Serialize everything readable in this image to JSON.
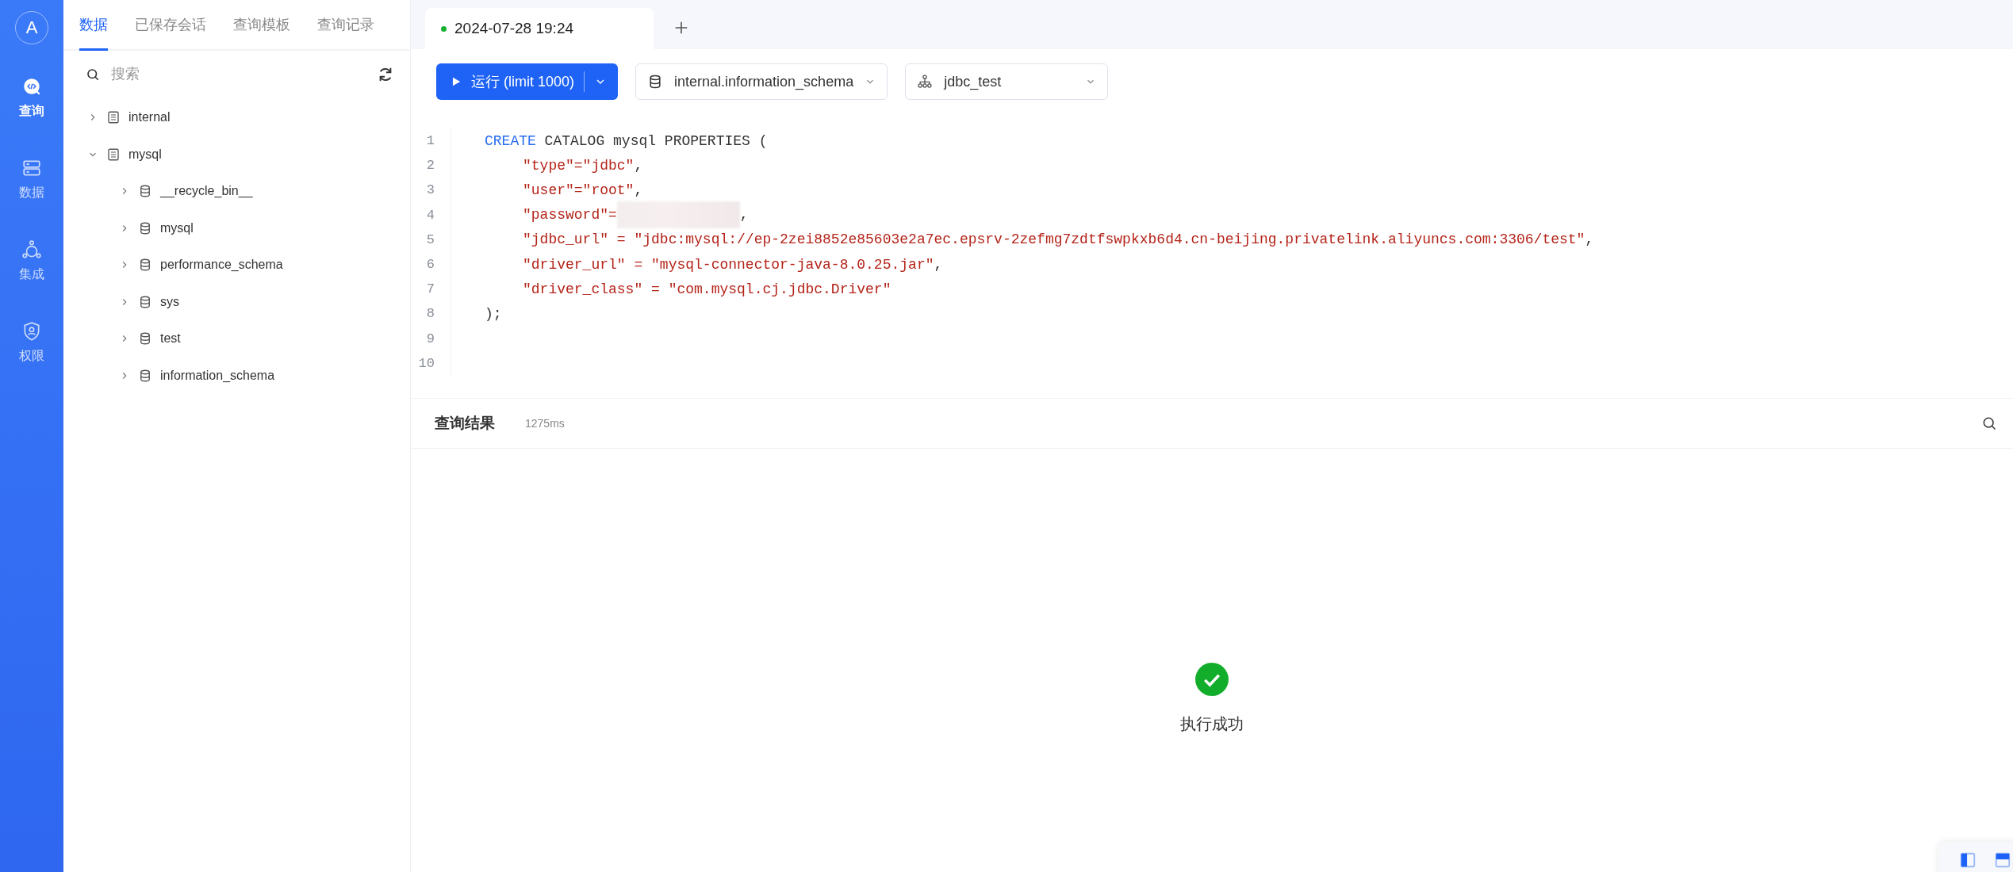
{
  "nav": {
    "avatar": "A",
    "items": [
      {
        "label": "查询",
        "selected": true
      },
      {
        "label": "数据",
        "selected": false
      },
      {
        "label": "集成",
        "selected": false
      },
      {
        "label": "权限",
        "selected": false
      }
    ]
  },
  "sidebar": {
    "tabs": [
      {
        "label": "数据",
        "selected": true
      },
      {
        "label": "已保存会话",
        "selected": false
      },
      {
        "label": "查询模板",
        "selected": false
      },
      {
        "label": "查询记录",
        "selected": false
      }
    ],
    "search": {
      "placeholder": "搜索"
    },
    "tree": [
      {
        "label": "internal",
        "kind": "catalog",
        "expanded": false
      },
      {
        "label": "mysql",
        "kind": "catalog",
        "expanded": true,
        "children": [
          {
            "label": "__recycle_bin__",
            "kind": "database",
            "expanded": false
          },
          {
            "label": "mysql",
            "kind": "database",
            "expanded": false
          },
          {
            "label": "performance_schema",
            "kind": "database",
            "expanded": false
          },
          {
            "label": "sys",
            "kind": "database",
            "expanded": false
          },
          {
            "label": "test",
            "kind": "database",
            "expanded": false
          },
          {
            "label": "information_schema",
            "kind": "database",
            "expanded": false
          }
        ]
      }
    ]
  },
  "editor_tabs": [
    {
      "label": "2024-07-28 19:24",
      "selected": true,
      "color": "#16b030"
    }
  ],
  "toolbar": {
    "run_button": "运行 (limit 1000)",
    "database_select": "internal.information_schema",
    "cluster_select": "jdbc_test"
  },
  "code": [
    {
      "number": "1",
      "indent": false,
      "tokens": [
        {
          "kind": "keyword",
          "text": "CREATE"
        },
        {
          "kind": "plain",
          "text": " CATALOG mysql PROPERTIES ("
        }
      ]
    },
    {
      "number": "2",
      "indent": true,
      "tokens": [
        {
          "kind": "string",
          "text": "\"type\"=\"jdbc\""
        },
        {
          "kind": "plain",
          "text": ","
        }
      ]
    },
    {
      "number": "3",
      "indent": true,
      "tokens": [
        {
          "kind": "string",
          "text": "\"user\"=\"root\""
        },
        {
          "kind": "plain",
          "text": ","
        }
      ]
    },
    {
      "number": "4",
      "indent": true,
      "tokens": [
        {
          "kind": "string",
          "text": "\"password\"="
        },
        {
          "kind": "redacted"
        },
        {
          "kind": "plain",
          "text": ","
        }
      ]
    },
    {
      "number": "5",
      "indent": true,
      "tokens": [
        {
          "kind": "string",
          "text": "\"jdbc_url\" = \"jdbc:mysql://ep-2zei8852e85603e2a7ec.epsrv-2zefmg7zdtfswpkxb6d4.cn-beijing.privatelink.aliyuncs.com:3306/test\""
        },
        {
          "kind": "plain",
          "text": ","
        }
      ]
    },
    {
      "number": "6",
      "indent": true,
      "tokens": [
        {
          "kind": "string",
          "text": "\"driver_url\" = \"mysql-connector-java-8.0.25.jar\""
        },
        {
          "kind": "plain",
          "text": ","
        }
      ]
    },
    {
      "number": "7",
      "indent": true,
      "tokens": [
        {
          "kind": "string",
          "text": "\"driver_class\" = \"com.mysql.cj.jdbc.Driver\""
        }
      ]
    },
    {
      "number": "8",
      "indent": false,
      "tokens": [
        {
          "kind": "plain",
          "text": ");"
        }
      ]
    },
    {
      "number": "9",
      "indent": false
    },
    {
      "number": "10",
      "indent": false
    }
  ],
  "results": {
    "title": "查询结果",
    "duration": "1275ms",
    "message": "执行成功"
  }
}
